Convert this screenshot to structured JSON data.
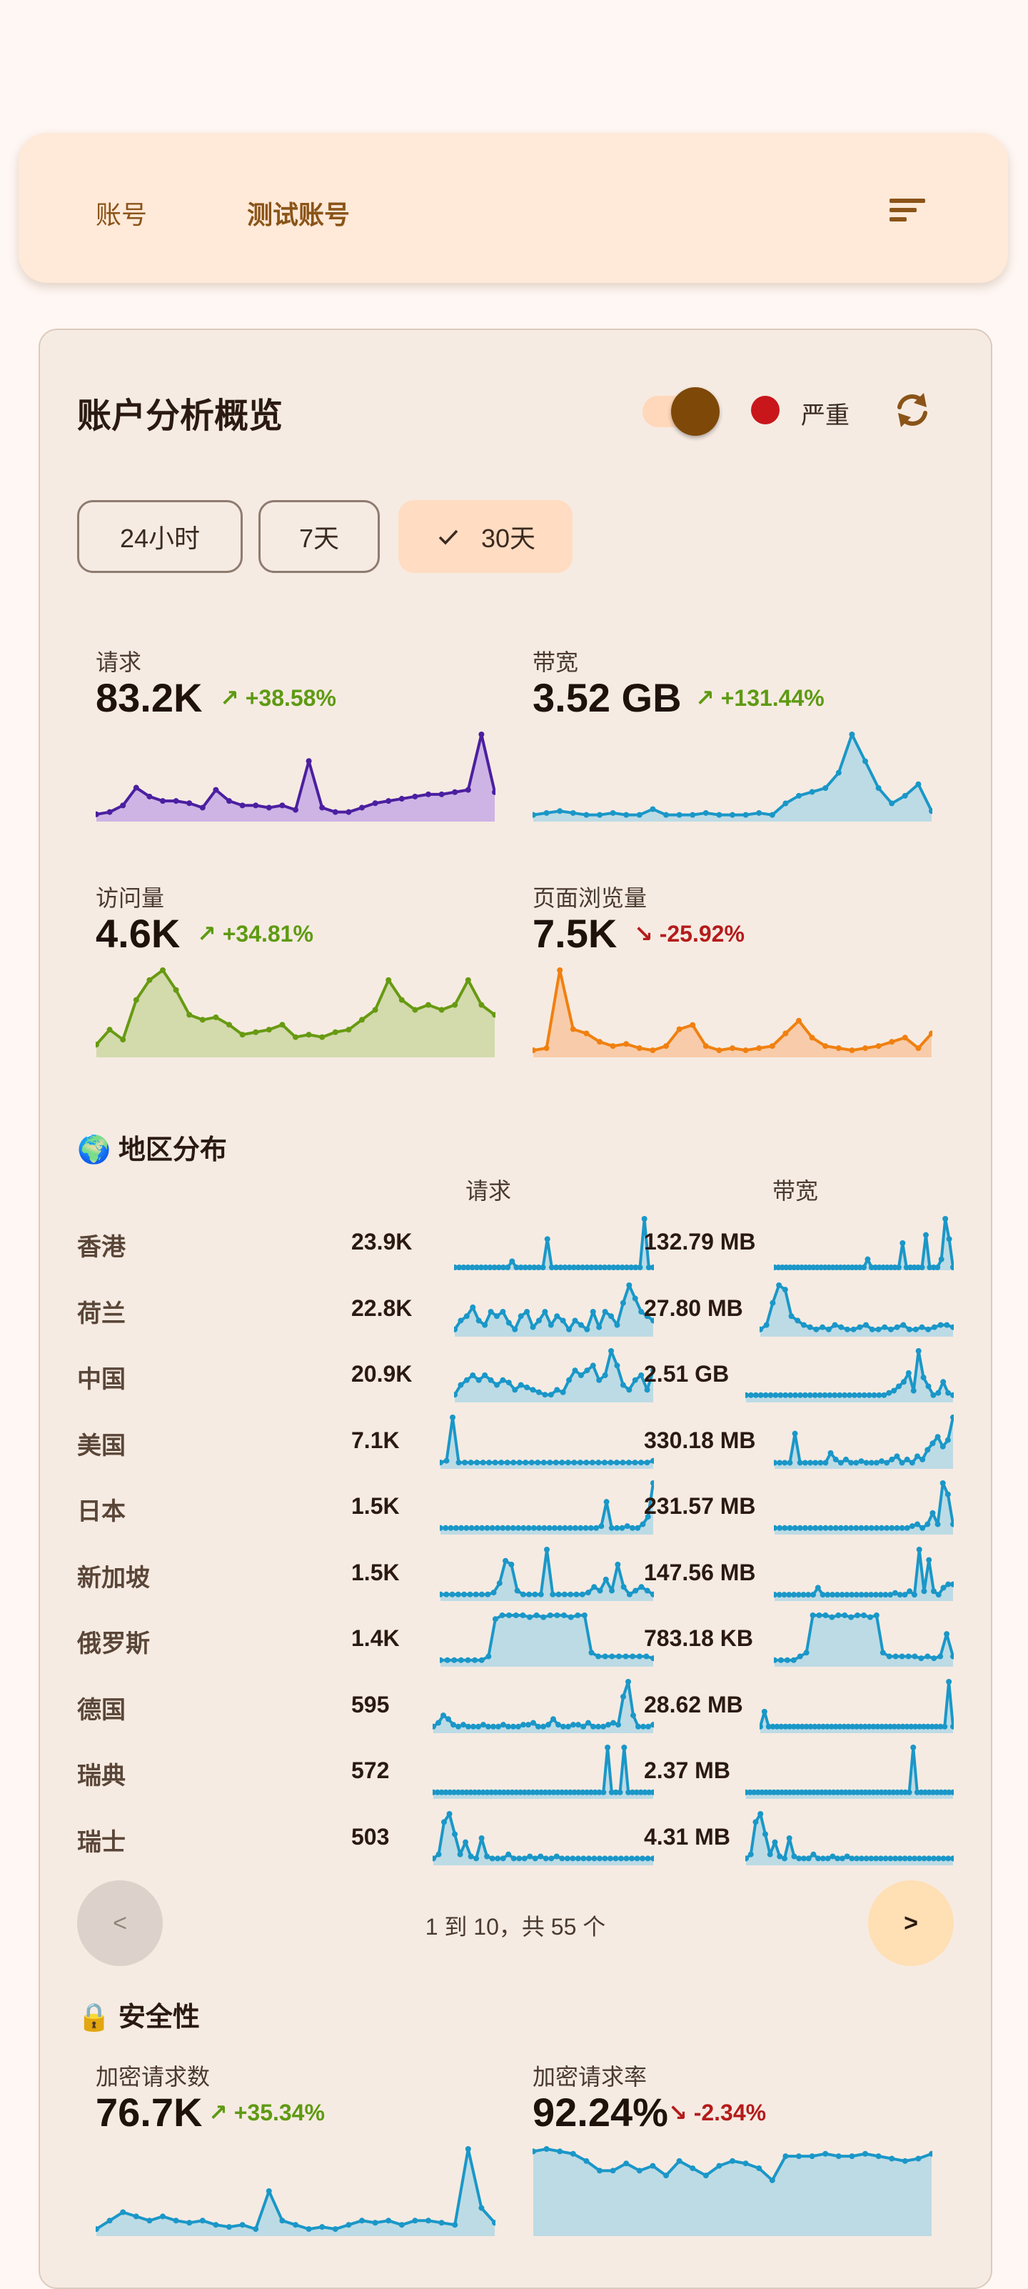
{
  "header": {
    "crumb_root": "账号",
    "crumb_current": "测试账号"
  },
  "card": {
    "title": "账户分析概览",
    "severity_label": "严重",
    "severity_color": "#c8161b",
    "accent": "#7e4808",
    "ranges": [
      {
        "label": "24小时",
        "selected": false
      },
      {
        "label": "7天",
        "selected": false
      },
      {
        "label": "30天",
        "selected": true
      }
    ]
  },
  "stats": [
    {
      "label": "请求",
      "value": "83.2K",
      "change": "+38.58%",
      "dir": "up",
      "color": "#4b1fa0",
      "fill": "#c9aee6",
      "series": [
        2,
        3,
        6,
        14,
        10,
        8,
        8,
        7,
        5,
        13,
        8,
        6,
        6,
        5,
        6,
        4,
        26,
        5,
        3,
        3,
        5,
        7,
        8,
        9,
        10,
        11,
        11,
        12,
        13,
        38,
        12
      ]
    },
    {
      "label": "带宽",
      "value": "3.52 GB",
      "change": "+131.44%",
      "dir": "up",
      "color": "#1a97c8",
      "fill": "#b7d9e6",
      "series": [
        2,
        3,
        4,
        3,
        2,
        2,
        3,
        2,
        2,
        5,
        2,
        2,
        2,
        3,
        2,
        2,
        2,
        3,
        2,
        8,
        12,
        14,
        16,
        24,
        44,
        30,
        16,
        8,
        12,
        18,
        4
      ]
    },
    {
      "label": "访问量",
      "value": "4.6K",
      "change": "+34.81%",
      "dir": "up",
      "color": "#679a12",
      "fill": "#cfd8a6",
      "series": [
        4,
        10,
        6,
        22,
        30,
        34,
        26,
        16,
        14,
        15,
        12,
        8,
        9,
        10,
        12,
        7,
        8,
        7,
        9,
        10,
        14,
        18,
        30,
        22,
        18,
        20,
        18,
        20,
        30,
        20,
        16
      ]
    },
    {
      "label": "页面浏览量",
      "value": "7.5K",
      "change": "-25.92%",
      "dir": "down",
      "color": "#f08010",
      "fill": "#f8c9a4",
      "series": [
        2,
        3,
        40,
        12,
        10,
        6,
        4,
        5,
        3,
        2,
        4,
        12,
        14,
        4,
        2,
        3,
        2,
        3,
        4,
        10,
        16,
        8,
        4,
        3,
        2,
        3,
        4,
        6,
        8,
        3,
        10
      ]
    }
  ],
  "regions": {
    "title": "地区分布",
    "col_requests": "请求",
    "col_bandwidth": "带宽",
    "rows": [
      {
        "name": "香港",
        "requests": "23.9K",
        "bandwidth": "132.79 MB",
        "req_series": [
          0,
          0,
          0,
          0,
          0,
          0,
          0,
          0,
          0,
          0,
          0,
          0,
          0,
          3,
          0,
          0,
          0,
          0,
          0,
          0,
          0,
          14,
          0,
          0,
          0,
          0,
          0,
          0,
          0,
          0,
          0,
          0,
          0,
          0,
          0,
          0,
          0,
          0,
          0,
          0,
          0,
          0,
          0,
          24,
          0,
          0
        ],
        "bw_series": [
          0,
          0,
          0,
          0,
          0,
          0,
          0,
          0,
          0,
          0,
          0,
          0,
          0,
          0,
          0,
          0,
          0,
          0,
          0,
          0,
          0,
          0,
          0,
          0,
          4,
          0,
          0,
          0,
          0,
          0,
          0,
          0,
          0,
          12,
          0,
          0,
          0,
          0,
          0,
          16,
          0,
          0,
          0,
          4,
          24,
          14,
          0
        ]
      },
      {
        "name": "荷兰",
        "requests": "22.8K",
        "bandwidth": "27.80 MB",
        "req_series": [
          2,
          6,
          8,
          12,
          6,
          4,
          10,
          8,
          10,
          5,
          2,
          8,
          10,
          3,
          6,
          10,
          4,
          8,
          6,
          2,
          6,
          4,
          2,
          10,
          3,
          10,
          8,
          4,
          14,
          22,
          16,
          10,
          8,
          6
        ],
        "bw_series": [
          2,
          4,
          14,
          22,
          20,
          8,
          6,
          4,
          3,
          2,
          3,
          2,
          4,
          3,
          2,
          2,
          3,
          4,
          2,
          2,
          3,
          2,
          3,
          4,
          2,
          2,
          3,
          2,
          3,
          4,
          4,
          3
        ]
      },
      {
        "name": "中国",
        "requests": "20.9K",
        "bandwidth": "2.51 GB",
        "req_series": [
          2,
          6,
          8,
          10,
          8,
          10,
          8,
          6,
          8,
          7,
          4,
          6,
          5,
          4,
          3,
          2,
          2,
          4,
          3,
          8,
          12,
          10,
          12,
          14,
          8,
          10,
          20,
          14,
          6,
          4,
          8,
          10,
          4,
          12
        ],
        "bw_series": [
          2,
          2,
          2,
          2,
          2,
          2,
          2,
          2,
          2,
          2,
          2,
          2,
          2,
          2,
          2,
          2,
          2,
          2,
          2,
          2,
          2,
          2,
          2,
          2,
          2,
          2,
          2,
          2,
          2,
          3,
          4,
          6,
          8,
          12,
          4,
          22,
          10,
          6,
          2,
          3,
          8,
          3,
          2
        ]
      },
      {
        "name": "美国",
        "requests": "7.1K",
        "bandwidth": "330.18 MB",
        "req_series": [
          2,
          3,
          28,
          2,
          2,
          2,
          2,
          2,
          2,
          2,
          2,
          2,
          2,
          2,
          2,
          2,
          2,
          2,
          2,
          2,
          2,
          2,
          2,
          2,
          2,
          2,
          2,
          2,
          2,
          2,
          2,
          2,
          2,
          2,
          2,
          3
        ],
        "bw_series": [
          2,
          2,
          2,
          2,
          20,
          2,
          2,
          2,
          2,
          2,
          2,
          8,
          4,
          2,
          4,
          2,
          2,
          3,
          2,
          2,
          2,
          3,
          2,
          4,
          6,
          2,
          4,
          2,
          6,
          4,
          10,
          14,
          18,
          12,
          16,
          30
        ]
      },
      {
        "name": "日本",
        "requests": "1.5K",
        "bandwidth": "231.57 MB",
        "req_series": [
          2,
          2,
          2,
          2,
          2,
          2,
          2,
          2,
          2,
          2,
          2,
          2,
          2,
          2,
          2,
          2,
          2,
          2,
          2,
          2,
          2,
          2,
          2,
          2,
          2,
          2,
          2,
          2,
          2,
          2,
          2,
          3,
          16,
          2,
          2,
          2,
          3,
          2,
          2,
          4,
          8,
          26
        ],
        "bw_series": [
          2,
          2,
          2,
          2,
          2,
          2,
          2,
          2,
          2,
          2,
          2,
          2,
          2,
          2,
          2,
          2,
          2,
          2,
          2,
          2,
          2,
          2,
          2,
          2,
          2,
          2,
          2,
          3,
          4,
          2,
          4,
          10,
          4,
          26,
          20,
          4
        ]
      },
      {
        "name": "新加坡",
        "requests": "1.5K",
        "bandwidth": "147.56 MB",
        "req_series": [
          2,
          2,
          2,
          2,
          2,
          2,
          2,
          2,
          2,
          3,
          8,
          20,
          18,
          4,
          2,
          2,
          2,
          2,
          26,
          2,
          2,
          2,
          2,
          2,
          2,
          3,
          6,
          4,
          10,
          4,
          18,
          6,
          2,
          4,
          6,
          4,
          2
        ],
        "bw_series": [
          2,
          2,
          2,
          2,
          2,
          2,
          2,
          2,
          2,
          6,
          2,
          2,
          2,
          2,
          2,
          2,
          2,
          2,
          2,
          2,
          2,
          2,
          2,
          2,
          2,
          3,
          2,
          2,
          4,
          2,
          28,
          4,
          22,
          4,
          2,
          6,
          8,
          8
        ]
      },
      {
        "name": "俄罗斯",
        "requests": "1.4K",
        "bandwidth": "783.18 KB",
        "req_series": [
          2,
          2,
          2,
          2,
          2,
          2,
          2,
          4,
          24,
          26,
          26,
          26,
          26,
          25,
          26,
          25,
          26,
          26,
          26,
          25,
          26,
          26,
          6,
          4,
          4,
          4,
          4,
          4,
          4,
          4,
          4,
          3
        ],
        "bw_series": [
          2,
          2,
          2,
          2,
          4,
          6,
          26,
          26,
          26,
          25,
          26,
          26,
          25,
          26,
          26,
          25,
          26,
          6,
          4,
          4,
          4,
          4,
          4,
          3,
          4,
          3,
          4,
          16,
          4
        ]
      },
      {
        "name": "德国",
        "requests": "595",
        "bandwidth": "28.62 MB",
        "req_series": [
          2,
          4,
          8,
          6,
          3,
          2,
          3,
          2,
          2,
          2,
          3,
          2,
          2,
          2,
          3,
          2,
          2,
          2,
          3,
          3,
          4,
          2,
          2,
          3,
          6,
          3,
          2,
          2,
          3,
          3,
          2,
          4,
          2,
          2,
          2,
          3,
          4,
          3,
          18,
          26,
          8,
          2,
          2,
          2,
          3
        ],
        "bw_series": [
          2,
          10,
          2,
          2,
          2,
          2,
          2,
          2,
          2,
          2,
          2,
          2,
          2,
          2,
          2,
          2,
          2,
          2,
          2,
          2,
          2,
          2,
          2,
          2,
          2,
          2,
          2,
          2,
          2,
          2,
          2,
          2,
          2,
          2,
          2,
          2,
          2,
          2,
          2,
          2,
          2,
          2,
          2,
          2,
          2,
          26,
          2
        ]
      },
      {
        "name": "瑞典",
        "requests": "572",
        "bandwidth": "2.37 MB",
        "req_series": [
          2,
          2,
          2,
          2,
          2,
          2,
          2,
          2,
          2,
          2,
          2,
          2,
          2,
          2,
          2,
          2,
          2,
          2,
          2,
          2,
          2,
          2,
          2,
          2,
          2,
          2,
          2,
          2,
          2,
          2,
          2,
          2,
          2,
          2,
          2,
          2,
          2,
          2,
          2,
          2,
          2,
          2,
          26,
          2,
          2,
          2,
          26,
          2,
          2,
          2,
          2,
          2,
          2,
          2
        ],
        "bw_series": [
          2,
          2,
          2,
          2,
          2,
          2,
          2,
          2,
          2,
          2,
          2,
          2,
          2,
          2,
          2,
          2,
          2,
          2,
          2,
          2,
          2,
          2,
          2,
          2,
          2,
          2,
          2,
          2,
          2,
          2,
          2,
          2,
          2,
          2,
          2,
          2,
          2,
          2,
          2,
          2,
          2,
          2,
          26,
          2,
          2,
          2,
          2,
          2,
          2,
          2,
          2,
          2,
          2
        ]
      },
      {
        "name": "瑞士",
        "requests": "503",
        "bandwidth": "4.31 MB",
        "req_series": [
          2,
          4,
          20,
          24,
          14,
          4,
          10,
          3,
          2,
          12,
          3,
          2,
          2,
          2,
          4,
          2,
          2,
          2,
          3,
          2,
          3,
          2,
          2,
          3,
          2,
          2,
          2,
          2,
          2,
          2,
          2,
          2,
          2,
          2,
          2,
          2,
          2,
          2,
          2,
          2,
          2,
          2
        ],
        "bw_series": [
          2,
          4,
          20,
          24,
          14,
          4,
          10,
          3,
          2,
          12,
          3,
          2,
          2,
          2,
          4,
          2,
          2,
          2,
          3,
          2,
          2,
          3,
          2,
          2,
          2,
          2,
          2,
          2,
          2,
          2,
          2,
          2,
          2,
          2,
          2,
          2,
          2,
          2,
          2,
          2,
          2,
          2,
          2,
          2
        ]
      }
    ]
  },
  "pagination": {
    "prev": "<",
    "next": ">",
    "info": "1 到 10，共 55 个"
  },
  "security": {
    "title": "安全性",
    "stats": [
      {
        "label": "加密请求数",
        "value": "76.7K",
        "change": "+35.34%",
        "dir": "up",
        "color": "#1a97c8",
        "fill": "#b7d9e6",
        "series": [
          2,
          6,
          10,
          8,
          6,
          8,
          6,
          5,
          6,
          4,
          3,
          4,
          2,
          20,
          6,
          4,
          2,
          3,
          2,
          4,
          6,
          5,
          6,
          4,
          6,
          6,
          5,
          4,
          40,
          12,
          5
        ]
      },
      {
        "label": "加密请求率",
        "value": "92.24%",
        "change": "-2.34%",
        "dir": "down",
        "color": "#1a97c8",
        "fill": "#b7d9e6",
        "series": [
          34,
          35,
          34,
          33,
          30,
          26,
          26,
          29,
          26,
          28,
          24,
          30,
          27,
          24,
          28,
          30,
          29,
          27,
          22,
          32,
          32,
          32,
          33,
          32,
          32,
          33,
          32,
          31,
          30,
          31,
          33
        ]
      }
    ]
  }
}
